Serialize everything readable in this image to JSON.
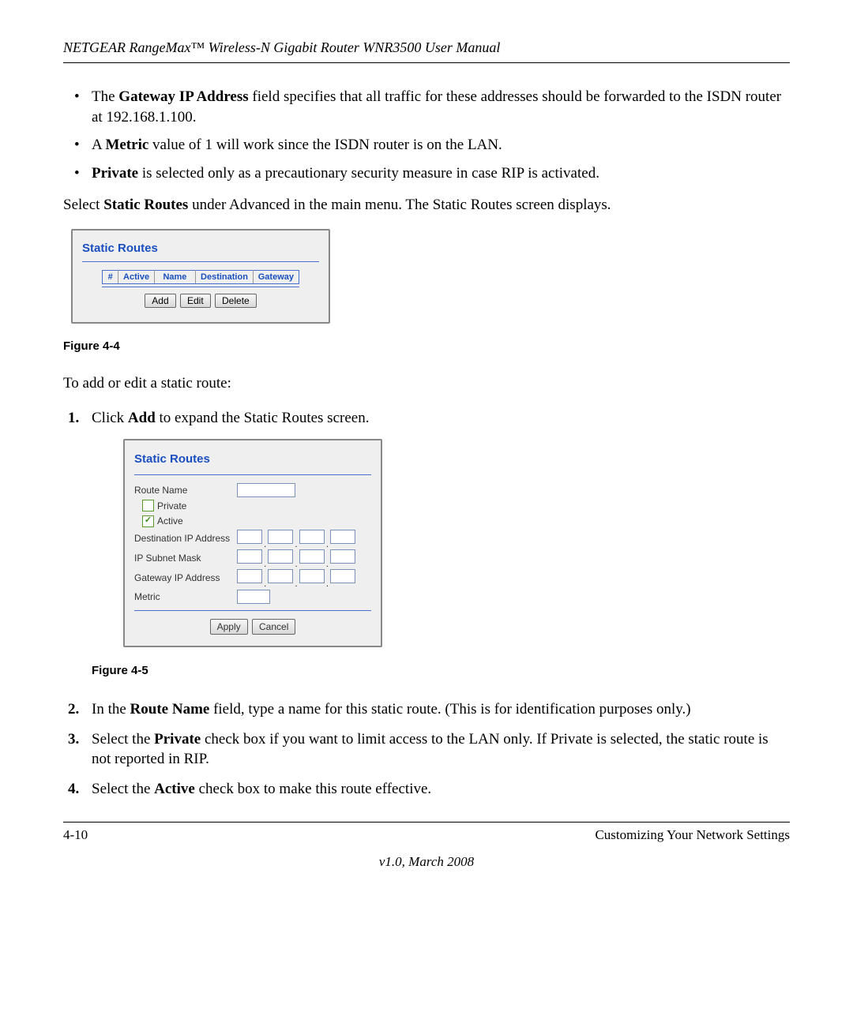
{
  "header": "NETGEAR RangeMax™ Wireless-N Gigabit Router WNR3500 User Manual",
  "bullets": {
    "b1_pre": "The ",
    "b1_bold": "Gateway IP Address",
    "b1_post": " field specifies that all traffic for these addresses should be forwarded to the ISDN router at 192.168.1.100.",
    "b2_pre": "A ",
    "b2_bold": "Metric",
    "b2_post": " value of 1 will work since the ISDN router is on the LAN.",
    "b3_bold": "Private",
    "b3_post": " is selected only as a precautionary security measure in case RIP is activated."
  },
  "para1_pre": "Select ",
  "para1_bold": "Static Routes",
  "para1_post": " under Advanced in the main menu. The Static Routes screen displays.",
  "fig1": {
    "title": "Static Routes",
    "headers": {
      "num": "#",
      "active": "Active",
      "name": "Name",
      "dest": "Destination",
      "gw": "Gateway"
    },
    "buttons": {
      "add": "Add",
      "edit": "Edit",
      "delete": "Delete"
    },
    "caption": "Figure 4-4"
  },
  "para2": "To add or edit a static route:",
  "step1_pre": "Click ",
  "step1_bold": "Add",
  "step1_post": " to expand the Static Routes screen.",
  "fig2": {
    "title": "Static Routes",
    "labels": {
      "routeName": "Route Name",
      "private": "Private",
      "active": "Active",
      "destIP": "Destination IP Address",
      "subnet": "IP Subnet Mask",
      "gwIP": "Gateway IP Address",
      "metric": "Metric"
    },
    "checks": {
      "private": "",
      "active": "✓"
    },
    "dot": ".",
    "buttons": {
      "apply": "Apply",
      "cancel": "Cancel"
    },
    "caption": "Figure 4-5"
  },
  "step2_pre": "In the ",
  "step2_bold": "Route Name",
  "step2_post": " field, type a name for this static route. (This is for identification purposes only.)",
  "step3_pre": "Select the ",
  "step3_bold": "Private",
  "step3_post": " check box if you want to limit access to the LAN only. If Private is selected, the static route is not reported in RIP.",
  "step4_pre": "Select the ",
  "step4_bold": "Active",
  "step4_post": " check box to make this route effective.",
  "footer": {
    "pageNum": "4-10",
    "section": "Customizing Your Network Settings"
  },
  "version": "v1.0, March 2008"
}
